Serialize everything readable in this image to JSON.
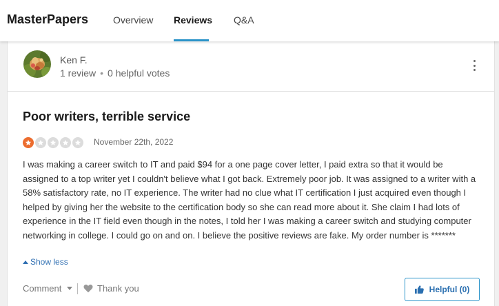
{
  "header": {
    "brand": "MasterPapers",
    "tabs": [
      {
        "label": "Overview"
      },
      {
        "label": "Reviews"
      },
      {
        "label": "Q&A"
      }
    ],
    "accent_color": "#2a93c9"
  },
  "reviewer": {
    "name": "Ken F.",
    "reviews": "1 review",
    "separator": "•",
    "helpful_votes": "0 helpful votes",
    "avatar": "flower-photo"
  },
  "review": {
    "title": "Poor writers, terrible service",
    "rating": 1,
    "max_rating": 5,
    "star_color": "#ec6d2f",
    "date": "November 22th, 2022",
    "body": "I was making a career switch to IT and paid $94 for a one page cover letter, I paid extra so that it would be assigned to a top writer yet I couldn't believe what I got back. Extremely poor job. It was assigned to a writer with a 58% satisfactory rate, no IT experience. The writer had no clue what IT certification I just acquired even though I helped by giving her the website to the certification body so she can read more about it. She claim I had lots of experience in the IT field even though in the notes, I told her I was making a career switch and studying computer networking in college. I could go on and on. I believe the positive reviews are fake. My order number is *******",
    "show_less": "Show less"
  },
  "actions": {
    "comment": "Comment",
    "thank_you": "Thank you",
    "helpful": "Helpful (0)"
  }
}
